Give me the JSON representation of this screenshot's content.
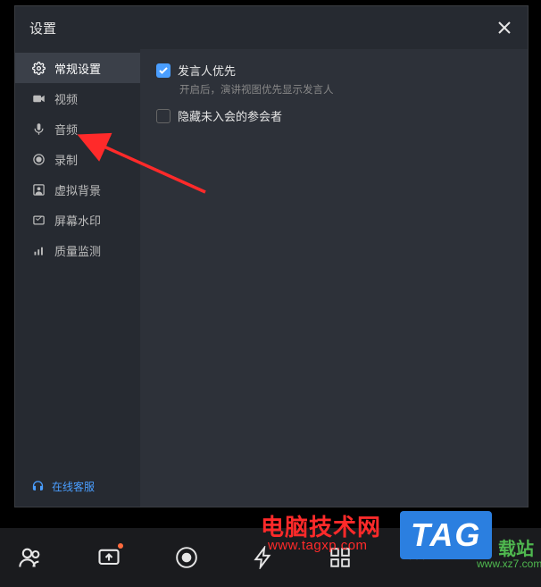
{
  "dialog": {
    "title": "设置"
  },
  "sidebar": {
    "items": [
      {
        "label": "常规设置"
      },
      {
        "label": "视频"
      },
      {
        "label": "音频"
      },
      {
        "label": "录制"
      },
      {
        "label": "虚拟背景"
      },
      {
        "label": "屏幕水印"
      },
      {
        "label": "质量监测"
      }
    ],
    "support_label": "在线客服"
  },
  "content": {
    "opt1_label": "发言人优先",
    "opt1_desc": "开启后，演讲视图优先显示发言人",
    "opt2_label": "隐藏未入会的参会者"
  },
  "watermarks": {
    "red_text": "电脑技术网",
    "red_url": "www.tagxp.com",
    "tag_text": "TAG",
    "yellow_text": "载站",
    "green_url": "www.xz7.com"
  }
}
